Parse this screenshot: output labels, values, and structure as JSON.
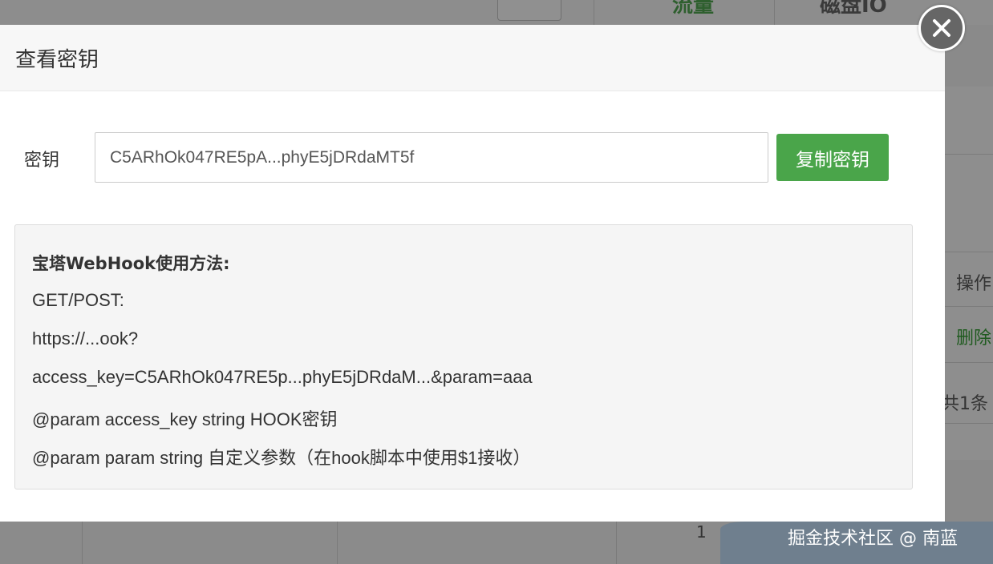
{
  "background": {
    "top_text_1": "流量",
    "top_text_2": "磁盘IO",
    "right_header": "操作",
    "right_link": "删除",
    "right_total": "共1条",
    "page_number": "1"
  },
  "modal": {
    "title": "查看密钥",
    "key_label": "密钥",
    "key_value": "C5ARhOk047RE5pA...phyE5jDRdaMT5f",
    "copy_button": "复制密钥",
    "help": {
      "title": "宝塔WebHook使用方法:",
      "method": "GET/POST:",
      "url": "https://...ook?",
      "params": "access_key=C5ARhOk047RE5p...phyE5jDRdaM...&param=aaa",
      "param1": "@param access_key string HOOK密钥",
      "param2": "@param param string 自定义参数（在hook脚本中使用$1接收）"
    }
  },
  "watermark": "掘金技术社区 @ 南蓝",
  "colors": {
    "accent_green": "#4aa54a",
    "close_button": "#666666"
  },
  "icons": {
    "close": "close-icon"
  }
}
